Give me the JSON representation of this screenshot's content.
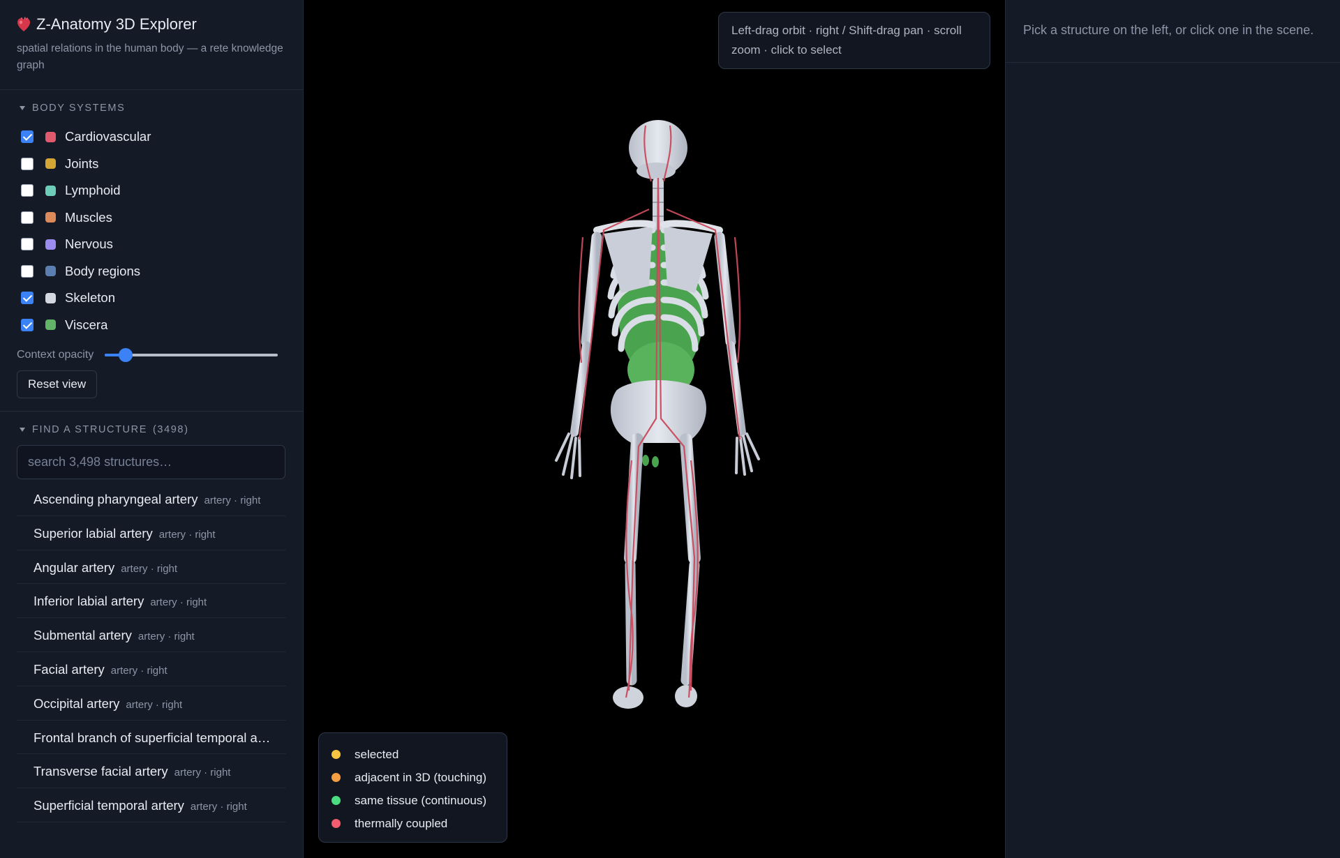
{
  "brand": {
    "title": "Z-Anatomy 3D Explorer",
    "subtitle": "spatial relations in the human body — a rete knowledge graph",
    "icon": "heart-icon"
  },
  "systems": {
    "heading": "BODY SYSTEMS",
    "items": [
      {
        "label": "Cardiovascular",
        "checked": true,
        "color": "#e05a6e"
      },
      {
        "label": "Joints",
        "checked": false,
        "color": "#d4a634"
      },
      {
        "label": "Lymphoid",
        "checked": false,
        "color": "#6ecdb8"
      },
      {
        "label": "Muscles",
        "checked": false,
        "color": "#dd8a5a"
      },
      {
        "label": "Nervous",
        "checked": false,
        "color": "#9c8cf0"
      },
      {
        "label": "Body regions",
        "checked": false,
        "color": "#5b7fb0"
      },
      {
        "label": "Skeleton",
        "checked": true,
        "color": "#d4d8e0"
      },
      {
        "label": "Viscera",
        "checked": true,
        "color": "#62b368"
      }
    ],
    "opacity_label": "Context opacity",
    "opacity_value": 0.12,
    "reset_label": "Reset view"
  },
  "find": {
    "heading": "FIND A STRUCTURE",
    "count": "(3498)",
    "placeholder": "search 3,498 structures…",
    "results": [
      {
        "name": "Ascending pharyngeal artery",
        "meta": "artery · right"
      },
      {
        "name": "Superior labial artery",
        "meta": "artery · right"
      },
      {
        "name": "Angular artery",
        "meta": "artery · right"
      },
      {
        "name": "Inferior labial artery",
        "meta": "artery · right"
      },
      {
        "name": "Submental artery",
        "meta": "artery · right"
      },
      {
        "name": "Facial artery",
        "meta": "artery · right"
      },
      {
        "name": "Occipital artery",
        "meta": "artery · right"
      },
      {
        "name": "Frontal branch of superficial temporal artery",
        "meta": ""
      },
      {
        "name": "Transverse facial artery",
        "meta": "artery · right"
      },
      {
        "name": "Superficial temporal artery",
        "meta": "artery · right"
      }
    ]
  },
  "viewport": {
    "hint": "Left-drag orbit · right / Shift-drag pan · scroll zoom · click to select",
    "legend": [
      {
        "label": "selected",
        "color": "#f5c542"
      },
      {
        "label": "adjacent in 3D (touching)",
        "color": "#f59e42"
      },
      {
        "label": "same tissue (continuous)",
        "color": "#4ade80"
      },
      {
        "label": "thermally coupled",
        "color": "#f25c6e"
      }
    ]
  },
  "details": {
    "message": "Pick a structure on the left, or click one in the scene."
  }
}
